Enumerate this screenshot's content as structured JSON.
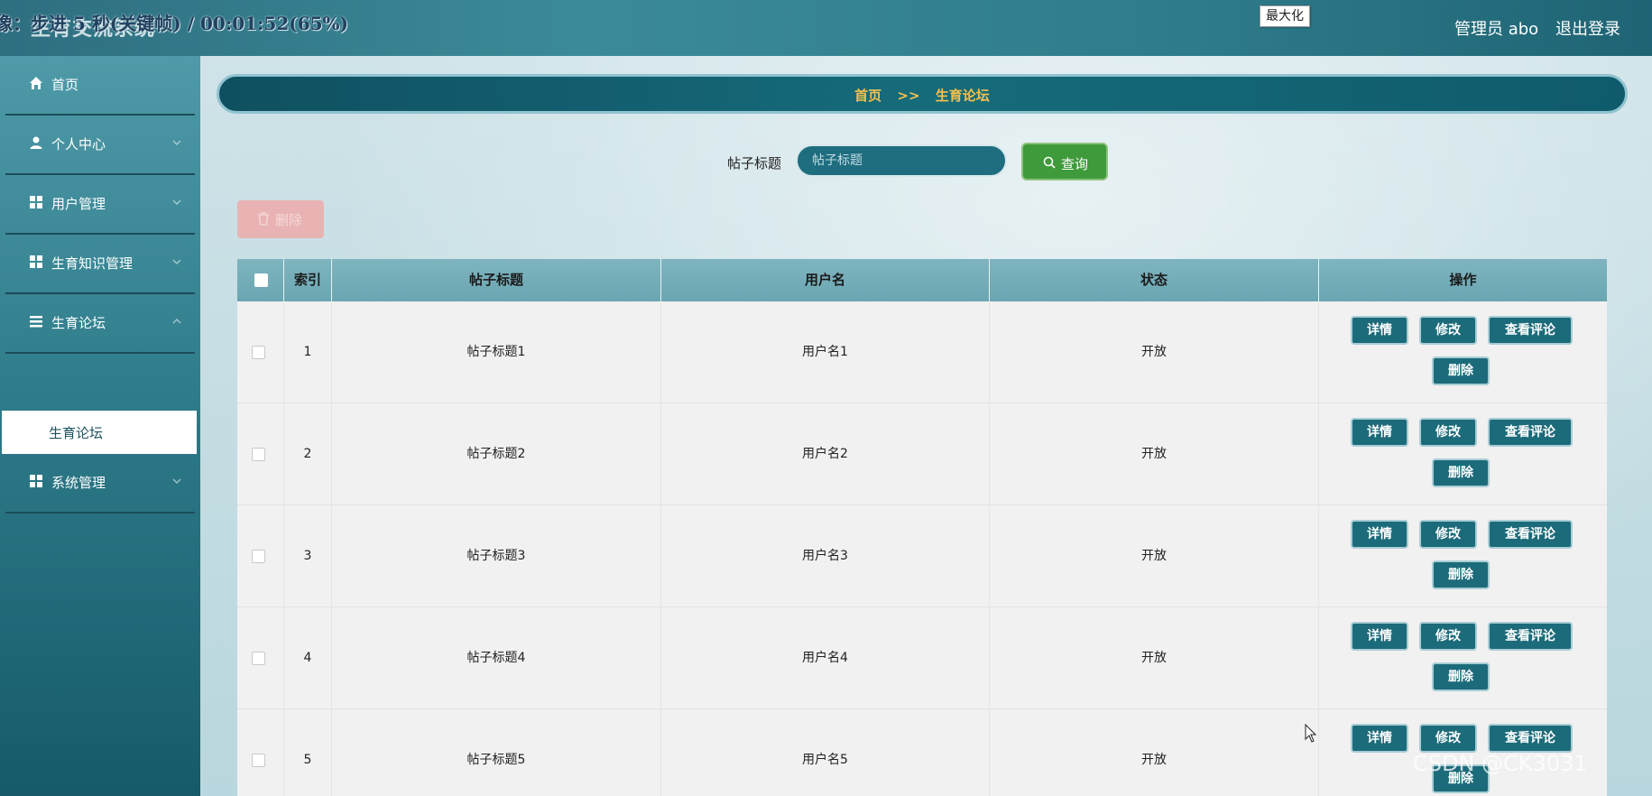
{
  "header": {
    "app_title": "生育交流系统",
    "overlay_progress": "像：步进 5 秒(关键帧) / 00:01:52(65%)",
    "maximize_tooltip": "最大化",
    "admin_label": "管理员 abo",
    "logout_label": "退出登录"
  },
  "sidebar": {
    "items": [
      {
        "label": "首页",
        "icon": "home-icon"
      },
      {
        "label": "个人中心",
        "icon": "user-icon"
      },
      {
        "label": "用户管理",
        "icon": "grid-icon"
      },
      {
        "label": "生育知识管理",
        "icon": "grid-icon"
      },
      {
        "label": "生育论坛",
        "icon": "list-icon"
      },
      {
        "label": "系统管理",
        "icon": "grid-icon"
      }
    ],
    "active_sub": "生育论坛"
  },
  "breadcrumb": {
    "home": "首页",
    "separator": ">>",
    "current": "生育论坛"
  },
  "search": {
    "label": "帖子标题",
    "placeholder": "帖子标题",
    "button_label": "查询"
  },
  "batch_delete_label": "删除",
  "table": {
    "headers": [
      "索引",
      "帖子标题",
      "用户名",
      "状态",
      "操作"
    ],
    "rows": [
      {
        "index": "1",
        "title": "帖子标题1",
        "user": "用户名1",
        "status": "开放"
      },
      {
        "index": "2",
        "title": "帖子标题2",
        "user": "用户名2",
        "status": "开放"
      },
      {
        "index": "3",
        "title": "帖子标题3",
        "user": "用户名3",
        "status": "开放"
      },
      {
        "index": "4",
        "title": "帖子标题4",
        "user": "用户名4",
        "status": "开放"
      },
      {
        "index": "5",
        "title": "帖子标题5",
        "user": "用户名5",
        "status": "开放"
      }
    ],
    "actions": {
      "detail": "详情",
      "edit": "修改",
      "view_comments": "查看评论",
      "delete": "删除"
    }
  },
  "watermark": "CSDN @CK3031",
  "colors": {
    "primary": "#1c6b7a",
    "query_green": "#3e9a3a",
    "breadcrumb_text": "#f2c14e",
    "disabled_delete": "#e9b3b3"
  }
}
